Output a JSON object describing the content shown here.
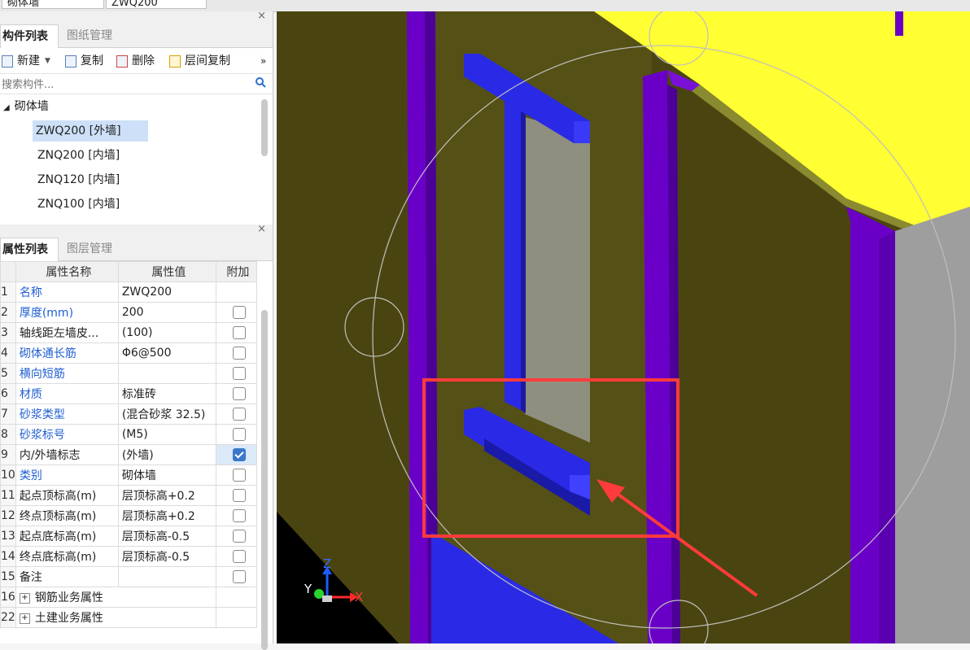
{
  "header": {
    "field_label": "砌体墙",
    "field_value": "ZWQ200"
  },
  "component_panel": {
    "close_glyph": "×",
    "tabs": [
      "构件列表",
      "图纸管理"
    ],
    "toolbar": {
      "new": "新建",
      "copy": "复制",
      "delete": "删除",
      "floor_copy": "层间复制",
      "more": "»"
    },
    "search_placeholder": "搜索构件...",
    "tree": {
      "root": "砌体墙",
      "items": [
        "ZWQ200 [外墙]",
        "ZNQ200 [内墙]",
        "ZNQ120 [内墙]",
        "ZNQ100 [内墙]"
      ]
    }
  },
  "property_panel": {
    "close_glyph": "×",
    "tabs": [
      "属性列表",
      "图层管理"
    ],
    "columns": [
      "属性名称",
      "属性值",
      "附加"
    ],
    "rows": [
      {
        "num": "1",
        "name": "名称",
        "value": "ZWQ200",
        "check": "none",
        "blue": true
      },
      {
        "num": "2",
        "name": "厚度(mm)",
        "value": "200",
        "check": "off",
        "blue": true
      },
      {
        "num": "3",
        "name": "轴线距左墙皮...",
        "value": "(100)",
        "check": "off",
        "blue": false
      },
      {
        "num": "4",
        "name": "砌体通长筋",
        "value": "Φ6@500",
        "check": "off",
        "blue": true
      },
      {
        "num": "5",
        "name": "横向短筋",
        "value": "",
        "check": "off",
        "blue": true
      },
      {
        "num": "6",
        "name": "材质",
        "value": "标准砖",
        "check": "off",
        "blue": true
      },
      {
        "num": "7",
        "name": "砂浆类型",
        "value": "(混合砂浆  32.5)",
        "check": "off",
        "blue": true
      },
      {
        "num": "8",
        "name": "砂浆标号",
        "value": "(M5)",
        "check": "off",
        "blue": true
      },
      {
        "num": "9",
        "name": "内/外墙标志",
        "value": "(外墙)",
        "check": "on",
        "blue": false
      },
      {
        "num": "10",
        "name": "类别",
        "value": "砌体墙",
        "check": "off",
        "blue": true
      },
      {
        "num": "11",
        "name": "起点顶标高(m)",
        "value": "层顶标高+0.2",
        "check": "off",
        "blue": false
      },
      {
        "num": "12",
        "name": "终点顶标高(m)",
        "value": "层顶标高+0.2",
        "check": "off",
        "blue": false
      },
      {
        "num": "13",
        "name": "起点底标高(m)",
        "value": "层顶标高-0.5",
        "check": "off",
        "blue": false
      },
      {
        "num": "14",
        "name": "终点底标高(m)",
        "value": "层顶标高-0.5",
        "check": "off",
        "blue": false
      },
      {
        "num": "15",
        "name": "备注",
        "value": "",
        "check": "off",
        "blue": false
      },
      {
        "num": "16",
        "name": "钢筋业务属性",
        "value": "",
        "check": "group",
        "blue": false
      },
      {
        "num": "22",
        "name": "土建业务属性",
        "value": "",
        "check": "group",
        "blue": false
      }
    ]
  },
  "viewport": {
    "axis_x": "X",
    "axis_y": "Y",
    "axis_z": "Z",
    "colors": {
      "wall": "#4a4510",
      "wall_face": "#575115",
      "column": "#6a00c8",
      "lintel": "#2a2ae6",
      "slab": "#ffff33",
      "window_glass": "#8f8f80",
      "highlight": "#ff3b3b"
    }
  }
}
